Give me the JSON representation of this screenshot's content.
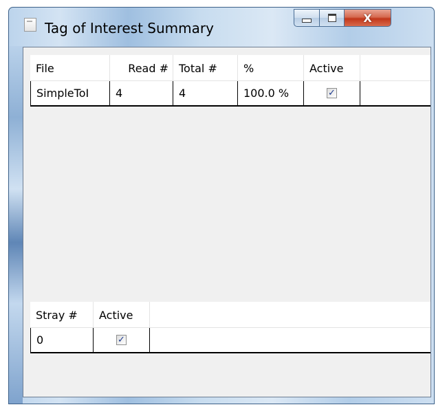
{
  "window": {
    "title": "Tag of Interest Summary",
    "close_glyph": "X"
  },
  "tags_table": {
    "columns": [
      "File",
      "Read #",
      "Total #",
      "%",
      "Active"
    ],
    "rows": [
      {
        "file": "SimpleToI",
        "read": "4",
        "total": "4",
        "percent": "100.0 %",
        "active": true
      }
    ]
  },
  "stray_table": {
    "columns": [
      "Stray #",
      "Active"
    ],
    "rows": [
      {
        "stray": "0",
        "active": true
      }
    ]
  },
  "checkbox_glyph": "✓",
  "colors": {
    "frame": "#bcd4ec",
    "close_button": "#c2371a",
    "client_background": "#f0f0f0",
    "check_mark": "#1d3b8f"
  }
}
